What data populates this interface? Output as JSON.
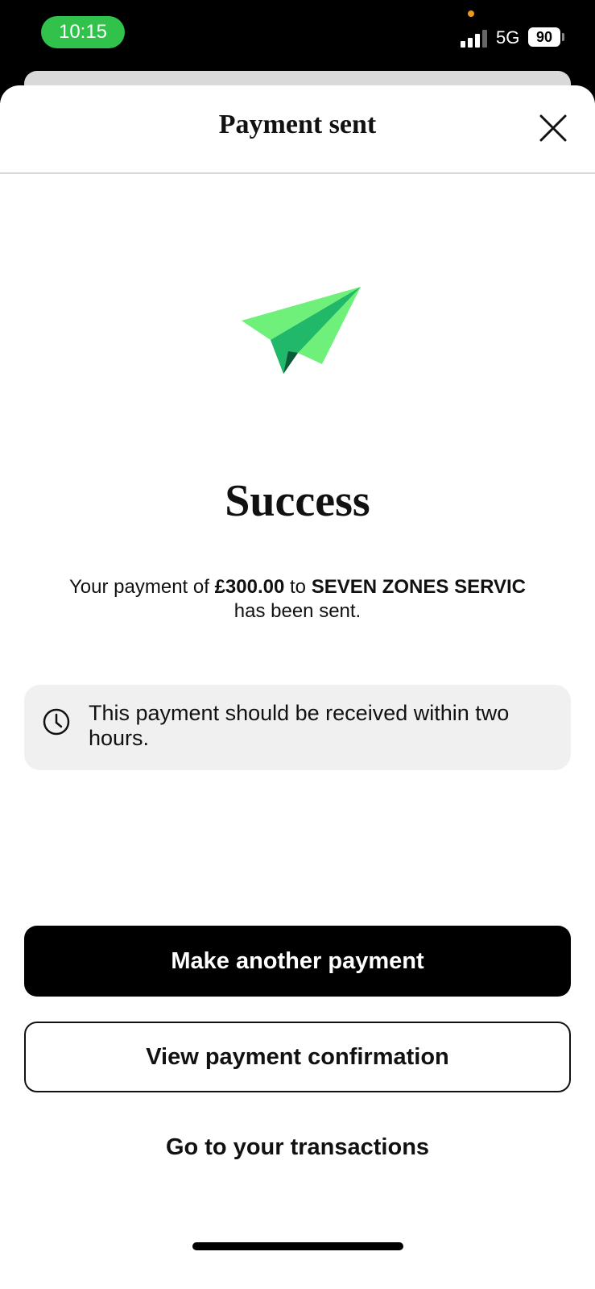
{
  "status_bar": {
    "time": "10:15",
    "network": "5G",
    "battery": "90",
    "icons": [
      "signal-icon",
      "battery-icon"
    ]
  },
  "header": {
    "title": "Payment sent",
    "close_icon": "close-icon"
  },
  "illustration": {
    "icon": "paper-plane-icon",
    "colors": {
      "light": "#6ef07a",
      "mid": "#22b86a",
      "dark": "#0b5a3a"
    }
  },
  "result": {
    "heading": "Success",
    "message_prefix": "Your payment of ",
    "amount": "£300.00",
    "message_middle": " to ",
    "payee": "SEVEN ZONES SERVIC",
    "message_suffix": "has been sent."
  },
  "info": {
    "icon": "clock-icon",
    "text": "This payment should be received within two hours."
  },
  "actions": {
    "primary_label": "Make another payment",
    "secondary_label": "View payment confirmation",
    "link_label": "Go to your transactions"
  },
  "colors": {
    "time_pill": "#30c24a",
    "primary_button": "#000000",
    "info_background": "#f0f0f0"
  }
}
